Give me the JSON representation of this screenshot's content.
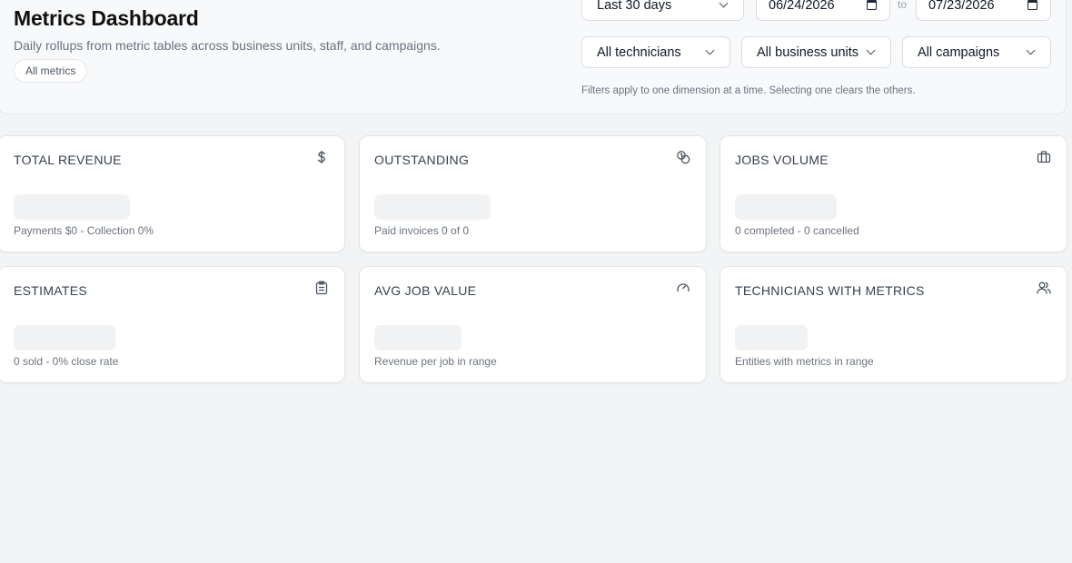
{
  "header": {
    "title": "Metrics Dashboard",
    "subtitle": "Daily rollups from metric tables across business units, staff, and campaigns.",
    "chip": "All metrics"
  },
  "filters": {
    "range": "Last 30 days",
    "date_from": "06/24/2026",
    "to_label": "to",
    "date_to": "07/23/2026",
    "technicians": "All technicians",
    "business_units": "All business units",
    "campaigns": "All campaigns",
    "note": "Filters apply to one dimension at a time. Selecting one clears the others."
  },
  "cards": [
    {
      "title": "TOTAL REVENUE",
      "sub": "Payments $0 - Collection 0%",
      "icon": "dollar-icon"
    },
    {
      "title": "OUTSTANDING",
      "sub": "Paid invoices 0 of 0",
      "icon": "coins-icon"
    },
    {
      "title": "JOBS VOLUME",
      "sub": "0 completed - 0 cancelled",
      "icon": "briefcase-icon"
    },
    {
      "title": "ESTIMATES",
      "sub": "0 sold - 0% close rate",
      "icon": "clipboard-icon"
    },
    {
      "title": "AVG JOB VALUE",
      "sub": "Revenue per job in range",
      "icon": "gauge-icon"
    },
    {
      "title": "TECHNICIANS WITH METRICS",
      "sub": "Entities with metrics in range",
      "icon": "users-icon"
    }
  ],
  "colors": {
    "background": "#f3f4f5",
    "card": "#ffffff",
    "skeleton": "#f1f2f4",
    "muted_text": "#6b7280"
  }
}
